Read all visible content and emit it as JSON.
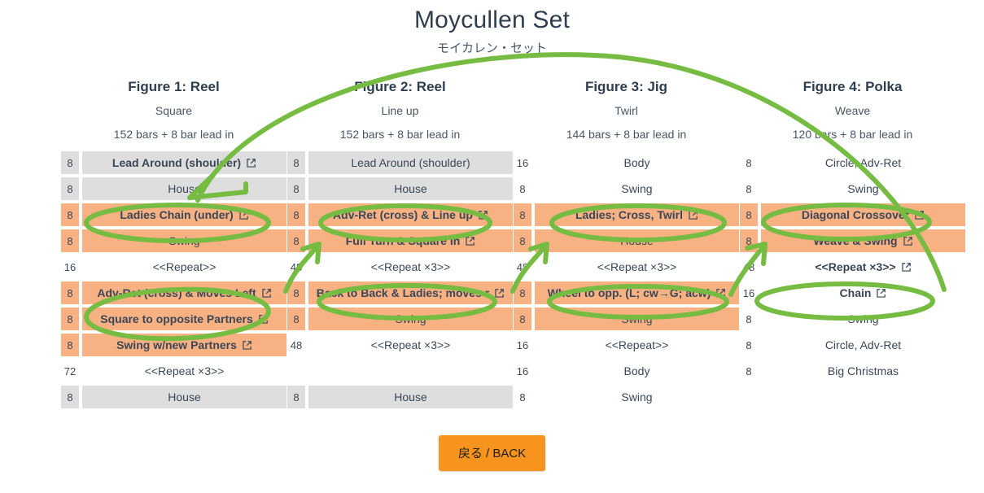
{
  "header": {
    "title": "Moycullen Set",
    "subtitle": "モイカレン・セット"
  },
  "colors": {
    "green": "#76bc43",
    "orange_row": "#f8b183",
    "grey_row": "#dedede",
    "button_orange": "#f7941e",
    "text": "#3b4756"
  },
  "columns": [
    {
      "head": "Figure 1: Reel",
      "sub": "Square",
      "bars": "152 bars + 8 bar lead in",
      "rows": [
        {
          "num": "8",
          "label": "Lead Around (shoulder)",
          "style": "grey",
          "bold": true,
          "link": true
        },
        {
          "num": "8",
          "label": "House",
          "style": "grey",
          "bold": false,
          "link": false
        },
        {
          "num": "8",
          "label": "Ladies Chain (under)",
          "style": "orange",
          "bold": true,
          "link": true
        },
        {
          "num": "8",
          "label": "Swing",
          "style": "orange",
          "bold": false,
          "link": false
        },
        {
          "num": "16",
          "label": "<<Repeat>>",
          "style": "plain",
          "bold": false,
          "link": false
        },
        {
          "num": "8",
          "label": "Adv-Ret (cross) & Moves Left",
          "style": "orange",
          "bold": true,
          "link": true
        },
        {
          "num": "8",
          "label": "Square to opposite Partners",
          "style": "orange",
          "bold": true,
          "link": true
        },
        {
          "num": "8",
          "label": "Swing w/new Partners",
          "style": "orange",
          "bold": true,
          "link": true
        },
        {
          "num": "72",
          "label": "<<Repeat ×3>>",
          "style": "plain",
          "bold": false,
          "link": false
        },
        {
          "num": "8",
          "label": "House",
          "style": "grey",
          "bold": false,
          "link": false
        }
      ]
    },
    {
      "head": "Figure 2: Reel",
      "sub": "Line up",
      "bars": "152 bars + 8 bar lead in",
      "rows": [
        {
          "num": "8",
          "label": "Lead Around (shoulder)",
          "style": "grey",
          "bold": false,
          "link": false
        },
        {
          "num": "8",
          "label": "House",
          "style": "grey",
          "bold": false,
          "link": false
        },
        {
          "num": "8",
          "label": "Adv-Ret (cross) & Line up",
          "style": "orange",
          "bold": true,
          "link": true
        },
        {
          "num": "8",
          "label": "Full Turn & Square In",
          "style": "orange",
          "bold": true,
          "link": true
        },
        {
          "num": "48",
          "label": "<<Repeat ×3>>",
          "style": "plain",
          "bold": false,
          "link": false
        },
        {
          "num": "8",
          "label": "Back to Back & Ladies; moves r",
          "style": "orange",
          "bold": true,
          "link": true
        },
        {
          "num": "8",
          "label": "Swing",
          "style": "orange",
          "bold": false,
          "link": false
        },
        {
          "num": "48",
          "label": "<<Repeat ×3>>",
          "style": "plain",
          "bold": false,
          "link": false
        },
        {
          "num": "",
          "label": "",
          "style": "empty",
          "bold": false,
          "link": false
        },
        {
          "num": "8",
          "label": "House",
          "style": "grey",
          "bold": false,
          "link": false
        }
      ]
    },
    {
      "head": "Figure 3: Jig",
      "sub": "Twirl",
      "bars": "144 bars + 8 bar lead in",
      "rows": [
        {
          "num": "16",
          "label": "Body",
          "style": "plain",
          "bold": false,
          "link": false
        },
        {
          "num": "8",
          "label": "Swing",
          "style": "plain",
          "bold": false,
          "link": false
        },
        {
          "num": "8",
          "label": "Ladies; Cross, Twirl",
          "style": "orange",
          "bold": true,
          "link": true
        },
        {
          "num": "8",
          "label": "House",
          "style": "orange",
          "bold": false,
          "link": false
        },
        {
          "num": "48",
          "label": "<<Repeat ×3>>",
          "style": "plain",
          "bold": false,
          "link": false
        },
        {
          "num": "8",
          "label": "Wheel to opp. (L; cw→G; acw)",
          "style": "orange",
          "bold": true,
          "link": true
        },
        {
          "num": "8",
          "label": "Swing",
          "style": "orange",
          "bold": false,
          "link": false
        },
        {
          "num": "16",
          "label": "<<Repeat>>",
          "style": "plain",
          "bold": false,
          "link": false
        },
        {
          "num": "16",
          "label": "Body",
          "style": "plain",
          "bold": false,
          "link": false
        },
        {
          "num": "8",
          "label": "Swing",
          "style": "plain",
          "bold": false,
          "link": false
        }
      ]
    },
    {
      "head": "Figure 4: Polka",
      "sub": "Weave",
      "bars": "120 bars + 8 bar lead in",
      "rows": [
        {
          "num": "8",
          "label": "Circle, Adv-Ret",
          "style": "plain",
          "bold": false,
          "link": false
        },
        {
          "num": "8",
          "label": "Swing",
          "style": "plain",
          "bold": false,
          "link": false
        },
        {
          "num": "8",
          "label": "Diagonal Crossover",
          "style": "orange",
          "bold": true,
          "link": true
        },
        {
          "num": "8",
          "label": "Weave & Swing",
          "style": "orange",
          "bold": true,
          "link": true
        },
        {
          "num": "48",
          "label": "<<Repeat ×3>>",
          "style": "plain",
          "bold": true,
          "link": true
        },
        {
          "num": "16",
          "label": "Chain",
          "style": "plain",
          "bold": true,
          "link": true
        },
        {
          "num": "8",
          "label": "Swing",
          "style": "plain",
          "bold": false,
          "link": false
        },
        {
          "num": "8",
          "label": "Circle, Adv-Ret",
          "style": "plain",
          "bold": false,
          "link": false
        },
        {
          "num": "8",
          "label": "Big Christmas",
          "style": "plain",
          "bold": false,
          "link": false
        }
      ]
    }
  ],
  "footer": {
    "back_label": "戻る / BACK"
  },
  "annotations": {
    "ellipse_count": 9,
    "arrow_count": 4,
    "ink_color": "#76bc43"
  }
}
